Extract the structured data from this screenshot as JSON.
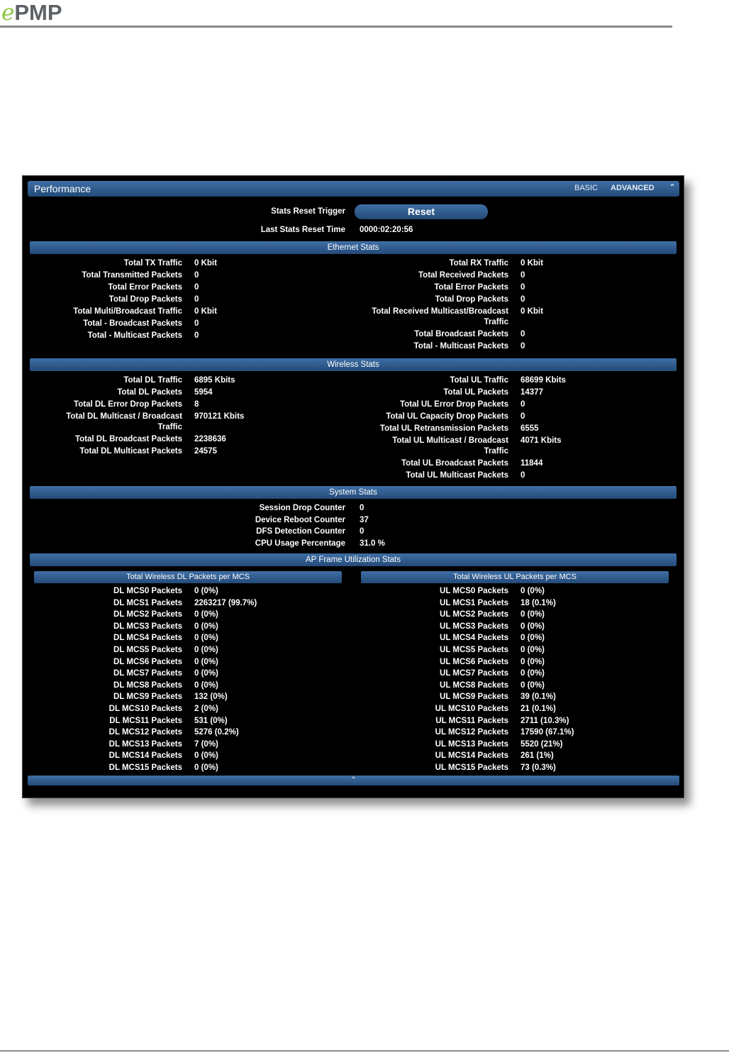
{
  "logo": {
    "e": "e",
    "pmp": "PMP"
  },
  "panel": {
    "title": "Performance",
    "tab_basic": "BASIC",
    "tab_advanced": "ADVANCED",
    "collapse_icon": "⌃",
    "footer_icon": "⌃"
  },
  "reset": {
    "trigger_label": "Stats Reset Trigger",
    "button_label": "Reset",
    "last_time_label": "Last Stats Reset Time",
    "last_time_value": "0000:02:20:56"
  },
  "ethernet": {
    "title": "Ethernet Stats",
    "left": [
      {
        "label": "Total TX Traffic",
        "value": "0 Kbit"
      },
      {
        "label": "Total Transmitted Packets",
        "value": "0"
      },
      {
        "label": "Total Error Packets",
        "value": "0"
      },
      {
        "label": "Total Drop Packets",
        "value": "0"
      },
      {
        "label": "Total Multi/Broadcast Traffic",
        "value": "0 Kbit"
      },
      {
        "label": "Total - Broadcast Packets",
        "value": "0"
      },
      {
        "label": "Total - Multicast Packets",
        "value": "0"
      }
    ],
    "right": [
      {
        "label": "Total RX Traffic",
        "value": "0 Kbit"
      },
      {
        "label": "Total Received Packets",
        "value": "0"
      },
      {
        "label": "Total Error Packets",
        "value": "0"
      },
      {
        "label": "Total Drop Packets",
        "value": "0"
      },
      {
        "label": "Total Received Multicast/Broadcast",
        "label2": "Traffic",
        "value": "0 Kbit"
      },
      {
        "label": "Total Broadcast Packets",
        "value": "0"
      },
      {
        "label": "Total - Multicast Packets",
        "value": "0"
      }
    ]
  },
  "wireless": {
    "title": "Wireless Stats",
    "left": [
      {
        "label": "Total DL Traffic",
        "value": "6895 Kbits"
      },
      {
        "label": "Total DL Packets",
        "value": "5954"
      },
      {
        "label": "Total DL Error Drop Packets",
        "value": "8"
      },
      {
        "label": "Total DL Multicast / Broadcast",
        "label2": "Traffic",
        "value": "970121 Kbits"
      },
      {
        "label": "Total DL Broadcast Packets",
        "value": "2238636"
      },
      {
        "label": "Total DL Multicast Packets",
        "value": "24575"
      }
    ],
    "right": [
      {
        "label": "Total UL Traffic",
        "value": "68699 Kbits"
      },
      {
        "label": "Total UL Packets",
        "value": "14377"
      },
      {
        "label": "Total UL Error Drop Packets",
        "value": "0"
      },
      {
        "label": "Total UL Capacity Drop Packets",
        "value": "0"
      },
      {
        "label": "Total UL Retransmission Packets",
        "value": "6555"
      },
      {
        "label": "Total UL Multicast / Broadcast",
        "label2": "Traffic",
        "value": "4071 Kbits"
      },
      {
        "label": "Total UL Broadcast Packets",
        "value": "11844"
      },
      {
        "label": "Total UL Multicast Packets",
        "value": "0"
      }
    ]
  },
  "system": {
    "title": "System Stats",
    "rows": [
      {
        "label": "Session Drop Counter",
        "value": "0"
      },
      {
        "label": "Device Reboot Counter",
        "value": "37"
      },
      {
        "label": "DFS Detection Counter",
        "value": "0"
      },
      {
        "label": "CPU Usage Percentage",
        "value": "31.0 %"
      }
    ]
  },
  "ap_frame": {
    "title": "AP Frame Utilization Stats",
    "dl_title": "Total Wireless DL Packets per MCS",
    "ul_title": "Total Wireless UL Packets per MCS",
    "dl": [
      {
        "label": "DL MCS0 Packets",
        "value": "0   (0%)"
      },
      {
        "label": "DL MCS1 Packets",
        "value": "2263217   (99.7%)"
      },
      {
        "label": "DL MCS2 Packets",
        "value": "0   (0%)"
      },
      {
        "label": "DL MCS3 Packets",
        "value": "0   (0%)"
      },
      {
        "label": "DL MCS4 Packets",
        "value": "0   (0%)"
      },
      {
        "label": "DL MCS5 Packets",
        "value": "0   (0%)"
      },
      {
        "label": "DL MCS6 Packets",
        "value": "0   (0%)"
      },
      {
        "label": "DL MCS7 Packets",
        "value": "0   (0%)"
      },
      {
        "label": "DL MCS8 Packets",
        "value": "0   (0%)"
      },
      {
        "label": "DL MCS9 Packets",
        "value": "132   (0%)"
      },
      {
        "label": "DL MCS10 Packets",
        "value": "2   (0%)"
      },
      {
        "label": "DL MCS11 Packets",
        "value": "531   (0%)"
      },
      {
        "label": "DL MCS12 Packets",
        "value": "5276   (0.2%)"
      },
      {
        "label": "DL MCS13 Packets",
        "value": "7   (0%)"
      },
      {
        "label": "DL MCS14 Packets",
        "value": "0   (0%)"
      },
      {
        "label": "DL MCS15 Packets",
        "value": "0   (0%)"
      }
    ],
    "ul": [
      {
        "label": "UL MCS0 Packets",
        "value": "0   (0%)"
      },
      {
        "label": "UL MCS1 Packets",
        "value": "18   (0.1%)"
      },
      {
        "label": "UL MCS2 Packets",
        "value": "0   (0%)"
      },
      {
        "label": "UL MCS3 Packets",
        "value": "0   (0%)"
      },
      {
        "label": "UL MCS4 Packets",
        "value": "0   (0%)"
      },
      {
        "label": "UL MCS5 Packets",
        "value": "0   (0%)"
      },
      {
        "label": "UL MCS6 Packets",
        "value": "0   (0%)"
      },
      {
        "label": "UL MCS7 Packets",
        "value": "0   (0%)"
      },
      {
        "label": "UL MCS8 Packets",
        "value": "0   (0%)"
      },
      {
        "label": "UL MCS9 Packets",
        "value": "39   (0.1%)"
      },
      {
        "label": "UL MCS10 Packets",
        "value": "21   (0.1%)"
      },
      {
        "label": "UL MCS11 Packets",
        "value": "2711   (10.3%)"
      },
      {
        "label": "UL MCS12 Packets",
        "value": "17590   (67.1%)"
      },
      {
        "label": "UL MCS13 Packets",
        "value": "5520   (21%)"
      },
      {
        "label": "UL MCS14 Packets",
        "value": "261   (1%)"
      },
      {
        "label": "UL MCS15 Packets",
        "value": "73   (0.3%)"
      }
    ]
  }
}
